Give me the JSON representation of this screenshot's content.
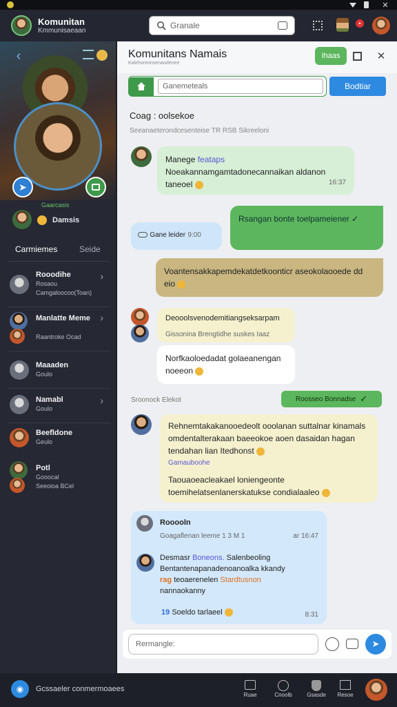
{
  "statusbar": {
    "left_icon": "app-dot-icon",
    "right_icons": [
      "wifi-icon",
      "battery-icon",
      "close-icon"
    ]
  },
  "topbar": {
    "app_name": "Komunitan",
    "app_subtitle": "Kmmunisaeaan",
    "search_placeholder": "Granale",
    "notification_badge": "•"
  },
  "sidebar": {
    "status_text": "Gaarcasis",
    "user_name": "Damsis",
    "tabs": {
      "active": "Carmiemes",
      "inactive": "Seide"
    },
    "items": [
      {
        "title": "Rooodihe",
        "line2": "Rosaou",
        "line3": "Camgaloocoo(Toan)",
        "chevron": "›"
      },
      {
        "title": "Manlatte Meme",
        "line2": "Raantroke Ocad",
        "chevron": "›"
      },
      {
        "title": "Maaaden",
        "line2": "Goulo"
      },
      {
        "title": "Namabl",
        "line2": "Goulo",
        "chevron": "›"
      },
      {
        "title": "Beefldone",
        "line2": "Geulo"
      },
      {
        "title": "Potl",
        "line2": "Gooocal",
        "line3": "Seeoioa BCel"
      }
    ]
  },
  "header": {
    "title": "Komunitans Namais",
    "subtitle": "Kalehoreonsenaodenee",
    "join_label": "Ihaas",
    "search_placeholder": "Ganemeteals",
    "action_label": "Bodtiar"
  },
  "chat": {
    "section_title": "Coag : oolsekoe",
    "section_sub": "Seeanaeterondcesenteise  TR  RSB  Sikreeloni",
    "messages": [
      {
        "name": "Manege",
        "tag": "feataps",
        "text": "Noeakannamgamtadonecannaikan aldanon taneoel",
        "time": "16:37"
      },
      {
        "text": "Rsangan bonte toelpameiener",
        "check": "✓"
      },
      {
        "text": "Gane leider",
        "time": "9:00"
      },
      {
        "text": "Voantensakkapemdekatdetkoonticr aseokolaooede dd eio"
      },
      {
        "name": "Deooolsvenodemitiangseksarpam",
        "sub": "Gissonina  Brengtidhe  suskes  Iaaz"
      },
      {
        "text": "Norfkaoloedadat golaeanengan noeeon"
      },
      {
        "label": "Sroonock  Elekot",
        "pill": "Roosseo Bonnadse",
        "pill_check": "✓"
      },
      {
        "text": "Rehnemtakakanooedeolt ooolanan suttalnar kinamals omdentalterakaan  baeeokoe aoen dasaidan hagan tendahan lian  Itedhonst",
        "tag": "Gamauboohe",
        "text2": "Taouaoeacleakael loniengeonte toemihelatsenlanerskatukse condialaaleo"
      },
      {
        "name": "Rooooln",
        "sub": "Goagaflenan  leeme  1 3 M 1",
        "time": "ar 16:47",
        "name2": "Desmasr",
        "tag2": "Boneons.",
        "name2b": "Salenbeoling",
        "text": "Bentantenapanadenoanoalka kkandy",
        "bold": "rag",
        "tag3": "teoaerenelen",
        "tag4": "Stardtusnon",
        "text3": "nannaokanny",
        "footer_num": "19",
        "footer_text": "Soeldo tarlaeel",
        "footer_time": "8:31"
      }
    ],
    "input_placeholder": "Rermangle:"
  },
  "bottombar": {
    "status_text": "Gcssaeler conmermoaees",
    "nav": [
      "Ruae",
      "Cnoolb",
      "Gsasde",
      "Resoe"
    ]
  },
  "colors": {
    "accent_green": "#5cb65e",
    "accent_blue": "#2d8ae0",
    "sidebar_bg": "#262833"
  }
}
